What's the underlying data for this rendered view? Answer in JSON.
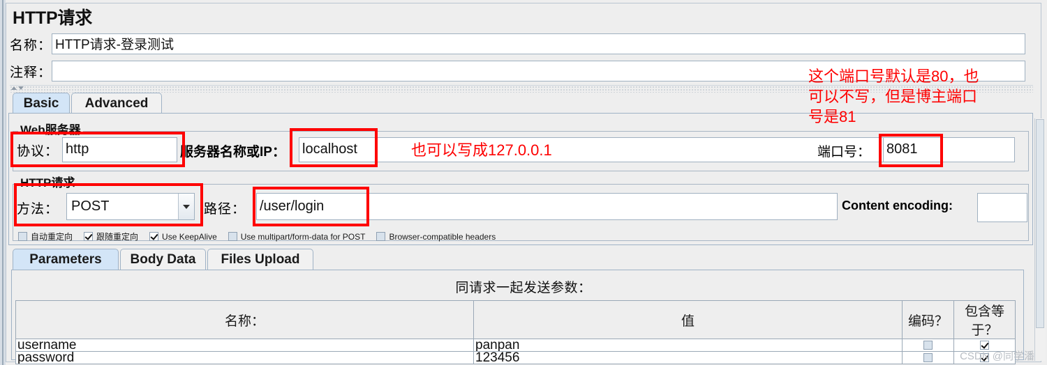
{
  "window": {
    "title": "HTTP请求"
  },
  "header": {
    "name_label": "名称：",
    "name_value": "HTTP请求-登录测试",
    "comment_label": "注释：",
    "comment_value": ""
  },
  "top_tabs": [
    {
      "label": "Basic",
      "active": true
    },
    {
      "label": "Advanced",
      "active": false
    }
  ],
  "web_server": {
    "legend": "Web服务器",
    "protocol_label": "协议：",
    "protocol_value": "http",
    "server_label": "服务器名称或IP：",
    "server_value": "localhost",
    "port_label": "端口号：",
    "port_value": "8081"
  },
  "http_request": {
    "legend": "HTTP请求",
    "method_label": "方法：",
    "method_value": "POST",
    "path_label": "路径：",
    "path_value": "/user/login",
    "content_encoding_label": "Content encoding:",
    "content_encoding_value": ""
  },
  "checkboxes": [
    {
      "label": "自动重定向",
      "checked": false
    },
    {
      "label": "跟随重定向",
      "checked": true
    },
    {
      "label": "Use KeepAlive",
      "checked": true
    },
    {
      "label": "Use multipart/form-data for POST",
      "checked": false
    },
    {
      "label": "Browser-compatible headers",
      "checked": false
    }
  ],
  "bottom_tabs": [
    {
      "label": "Parameters",
      "active": true
    },
    {
      "label": "Body Data",
      "active": false
    },
    {
      "label": "Files Upload",
      "active": false
    }
  ],
  "parameters": {
    "caption": "同请求一起发送参数：",
    "columns": [
      "名称：",
      "值",
      "编码？",
      "包含等于？"
    ],
    "rows": [
      {
        "name": "username",
        "value": "panpan",
        "encode": false,
        "include_equals": true
      },
      {
        "name": "password",
        "value": "123456",
        "encode": false,
        "include_equals": true
      }
    ]
  },
  "annotations": {
    "color": "#fe0000",
    "server_note": "也可以写成127.0.0.1",
    "port_note_line1": "这个端口号默认是80，也",
    "port_note_line2": "可以不写，但是博主端口",
    "port_note_line3": "号是81"
  },
  "watermark": "CSDN @同学潘"
}
